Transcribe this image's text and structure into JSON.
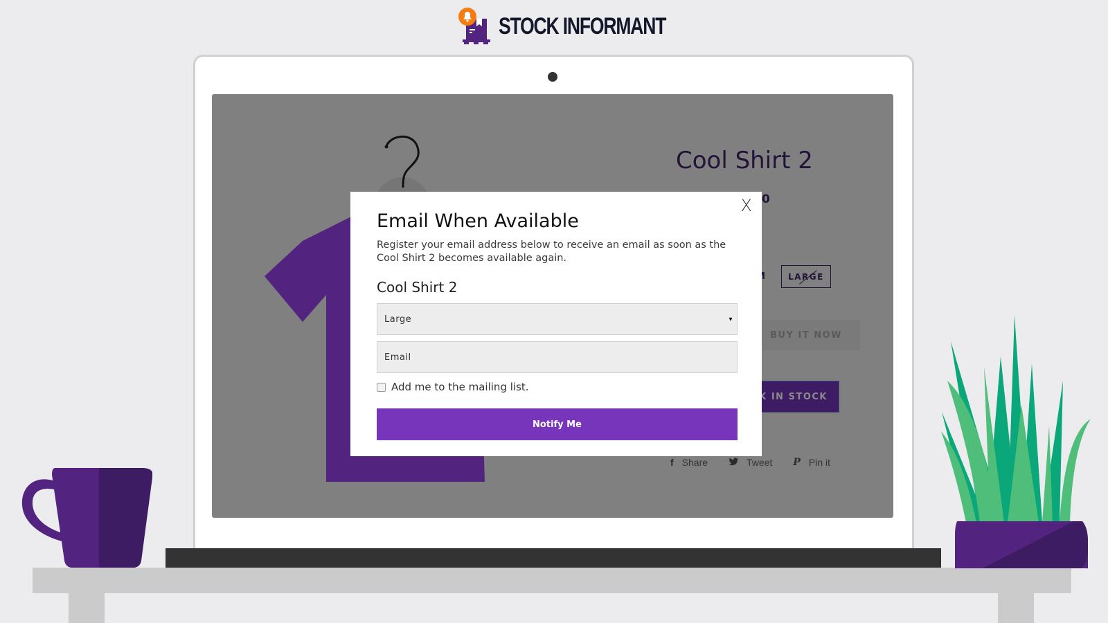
{
  "brand": {
    "name": "STOCK INFORMANT",
    "accent_color": "#7635bb",
    "bell_color": "#f57c11",
    "dark_purple": "#3d1c63"
  },
  "product_page": {
    "title": "Cool Shirt 2",
    "price_partial": "0",
    "size_partial": "M",
    "size_large": "LARGE",
    "buy_now": "BUY IT NOW",
    "back_in_stock_partial": "K IN STOCK",
    "share": [
      {
        "icon": "facebook-icon",
        "glyph": "f",
        "label": "Share"
      },
      {
        "icon": "twitter-icon",
        "glyph": "🐦",
        "label": "Tweet"
      },
      {
        "icon": "pinterest-icon",
        "glyph": "𝓟",
        "label": "Pin it"
      }
    ]
  },
  "modal": {
    "close_label": "X",
    "title": "Email When Available",
    "description": "Register your email address below to receive an email as soon as the Cool Shirt 2 becomes available again.",
    "product_name": "Cool Shirt 2",
    "variant_select": {
      "selected": "Large",
      "caret": "▾"
    },
    "email_field": {
      "value": "",
      "placeholder": "Email"
    },
    "mailing_list": {
      "label": "Add me to the mailing list.",
      "checked": false
    },
    "submit_label": "Notify Me"
  }
}
